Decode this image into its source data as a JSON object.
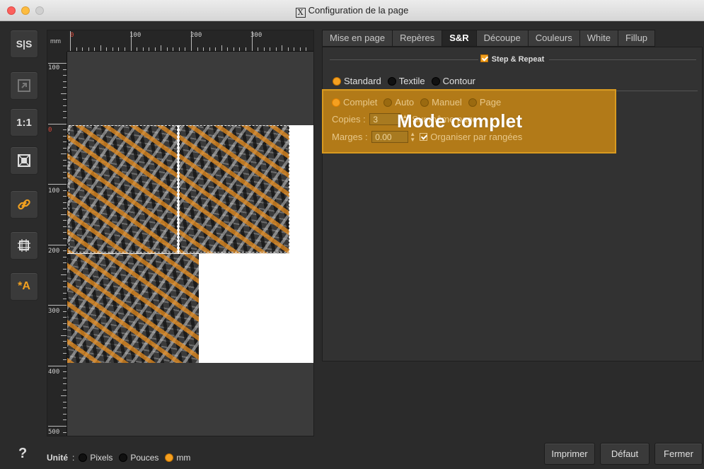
{
  "window": {
    "title": "Configuration de la page"
  },
  "toolbar": {
    "tools": [
      {
        "id": "sys",
        "label": "S|S"
      },
      {
        "id": "export",
        "label": ""
      },
      {
        "id": "one_to_one",
        "label": "1:1"
      },
      {
        "id": "fit",
        "label": ""
      },
      {
        "id": "link",
        "label": ""
      },
      {
        "id": "frame",
        "label": ""
      },
      {
        "id": "auto_text",
        "label": "*A"
      }
    ]
  },
  "ruler": {
    "unit": "mm",
    "top_labels": [
      "0",
      "100",
      "200",
      "300"
    ],
    "left_labels": [
      "100",
      "0",
      "100",
      "200",
      "300",
      "400",
      "500"
    ]
  },
  "tabs": [
    "Mise en page",
    "Repères",
    "S&R",
    "Découpe",
    "Couleurs",
    "White",
    "Fillup"
  ],
  "active_tab": "S&R",
  "step_repeat": {
    "title": "Step & Repeat",
    "modes": [
      "Standard",
      "Textile",
      "Contour"
    ],
    "selected_mode": "Standard",
    "submodes": [
      "Complet",
      "Auto",
      "Manuel",
      "Page"
    ],
    "selected_submode": "Complet",
    "copies_label": "Copies",
    "copies_value": "3",
    "copies_suffix": "Sur même page",
    "marges_label": "Marges",
    "marges_value": "0.00",
    "organiser_label": "Organiser par rangées"
  },
  "overlay_title": "Mode complet",
  "footer": {
    "help": "?",
    "unit_label": "Unité",
    "unit_sep": ":",
    "units": [
      "Pixels",
      "Pouces",
      "mm"
    ],
    "selected_unit": "mm",
    "print_button": "Imprimer",
    "default_button": "Défaut",
    "close_button": "Fermer"
  }
}
